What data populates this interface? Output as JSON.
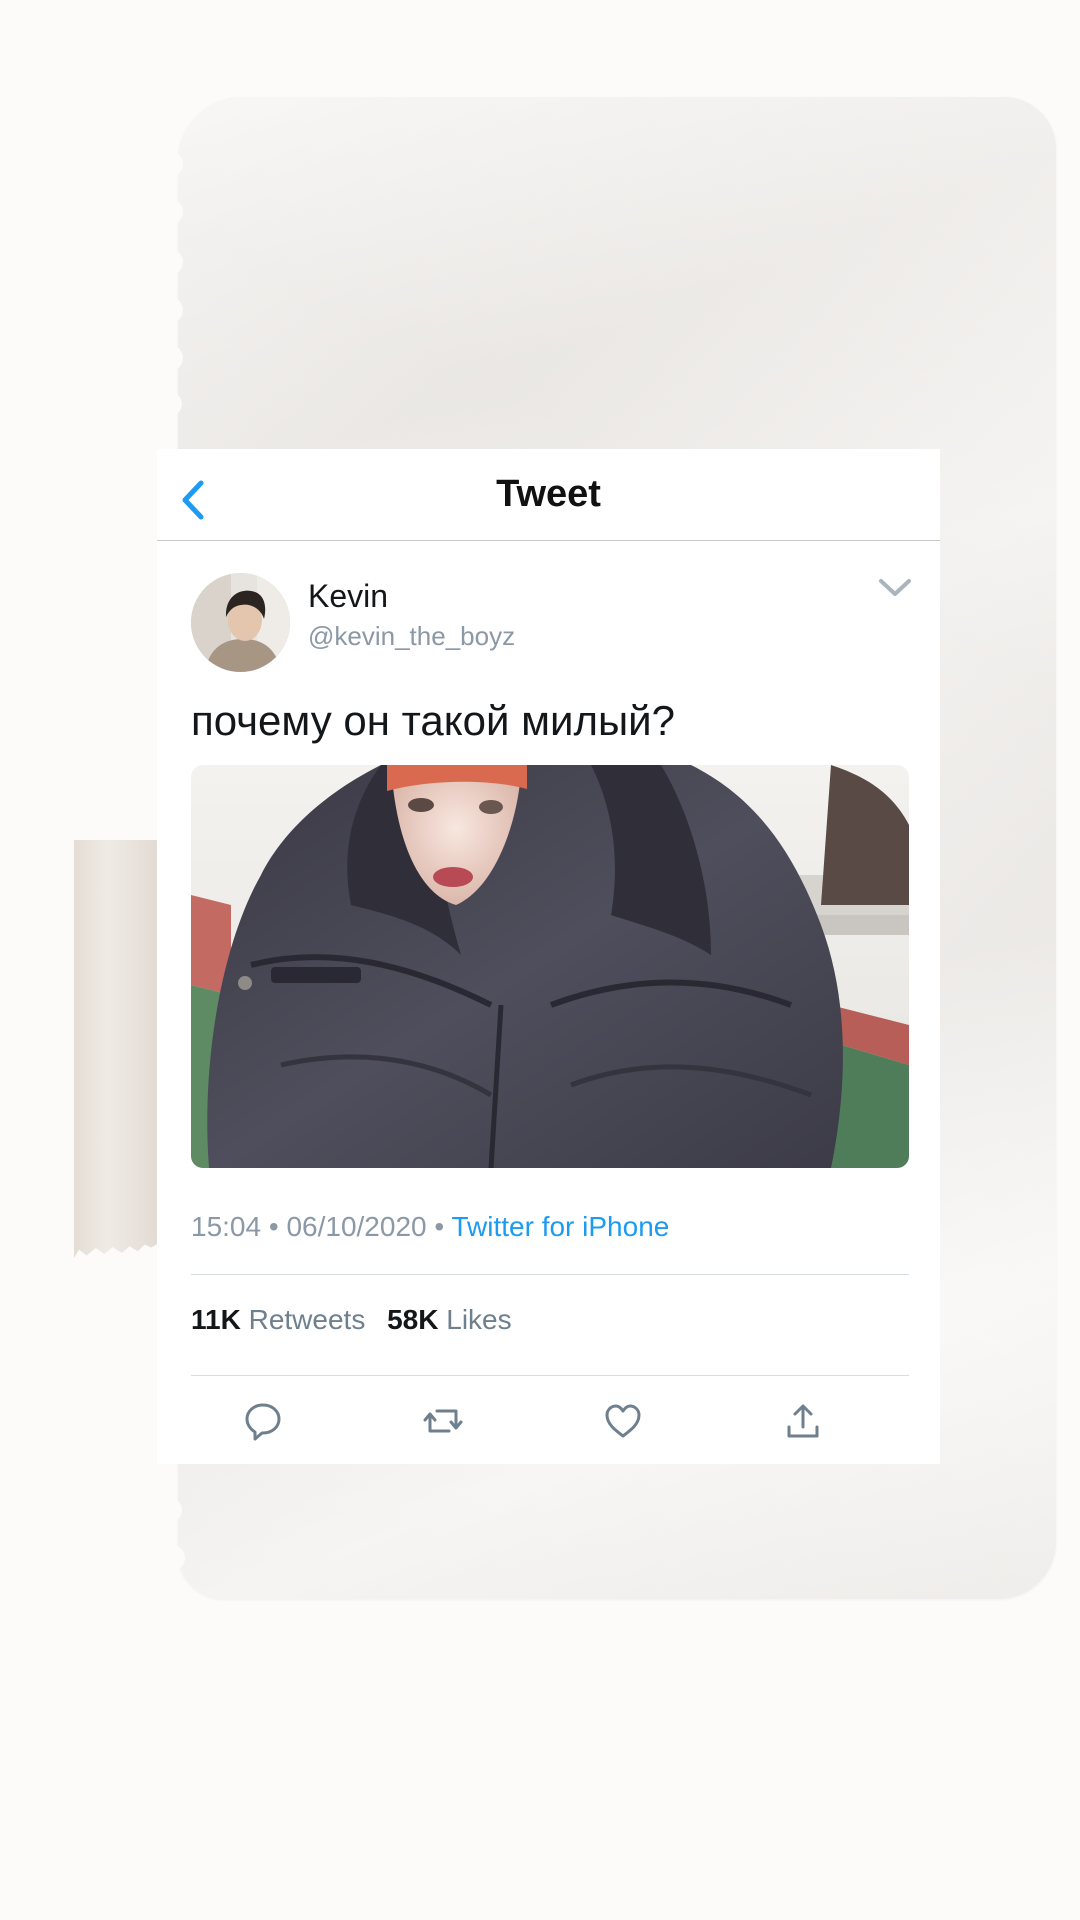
{
  "header": {
    "title": "Tweet",
    "back_icon": "chevron-left-icon"
  },
  "author": {
    "name": "Kevin",
    "handle": "@kevin_the_boyz",
    "menu_icon": "chevron-down-icon"
  },
  "tweet": {
    "text": "почему он такой милый?",
    "time": "15:04",
    "separator": "•",
    "date": "06/10/2020",
    "source": "Twitter for iPhone"
  },
  "stats": {
    "retweets_count": "11K",
    "retweets_label": "Retweets",
    "likes_count": "58K",
    "likes_label": "Likes"
  },
  "actions": [
    "reply-icon",
    "retweet-icon",
    "like-icon",
    "share-icon"
  ],
  "colors": {
    "accent": "#1d9bf0",
    "text_primary": "#14171a",
    "text_secondary": "#8b98a5",
    "page_background": "#fcfbfa",
    "paper": "#f3f0ed",
    "tape": "#ebe4dc"
  }
}
